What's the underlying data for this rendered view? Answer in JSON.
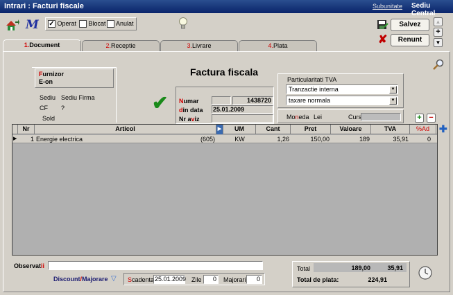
{
  "window": {
    "title": "Intrari : Facturi fiscale",
    "subunit_label": "Subunitate",
    "subunit_value": "Sediu Central"
  },
  "toolbar": {
    "operat": "Operat",
    "blocat": "Blocat",
    "anulat": "Anulat",
    "operat_checked": true
  },
  "actions": {
    "save": "Salvez",
    "cancel": "Renunt"
  },
  "tabs": [
    {
      "num": "1.",
      "label": "Document"
    },
    {
      "num": "2.",
      "label": "Receptie"
    },
    {
      "num": "3.",
      "label": "Livrare"
    },
    {
      "num": "4.",
      "label": "Plata"
    }
  ],
  "supplier": {
    "label_l1": "F",
    "label_r1": "urnizor",
    "name": "E-on",
    "sediu_label": "Sediu",
    "sediu_value": "Sediu Firma",
    "cf_label": "CF",
    "cf_value": "?",
    "sold_label": "Sold"
  },
  "invoice": {
    "title": "Factura fiscala",
    "numar_l": "N",
    "numar_r": "umar",
    "numar_value": "1438720",
    "data_l": "d",
    "data_r": "in data",
    "data_value": "25.01.2009",
    "aviz_l": "Nr a",
    "aviz_m": "v",
    "aviz_r": "iz",
    "aviz_value": ""
  },
  "tva": {
    "title": "Particularitati TVA",
    "option1": "Tranzactie interna",
    "option2": "taxare normala"
  },
  "currency": {
    "moneda_label_l": "Mo",
    "moneda_label_m": "n",
    "moneda_label_r": "eda",
    "moneda_value": "Lei",
    "curs_label": "Curs",
    "curs_value": ""
  },
  "grid": {
    "columns": [
      "Nr",
      "Articol",
      "UM",
      "Cant",
      "Pret",
      "Valoare",
      "TVA",
      "%Ad"
    ],
    "rows": [
      {
        "nr": "1",
        "articol": "Energie electrica",
        "code": "(605)",
        "um": "KW",
        "cant": "1,26",
        "pret": "150,00",
        "valoare": "189",
        "tva": "35,91",
        "ad": "0"
      }
    ]
  },
  "footer": {
    "obs_label_l": "Observat",
    "obs_label_r": "ii",
    "obs_value": "",
    "discount_label_l": "Discount",
    "discount_label_m": "/",
    "discount_label_r": "Majorare",
    "scadenta_l": "S",
    "scadenta_r": "cadenta",
    "scadenta_value": "25.01.2009",
    "zile_label": "Zile",
    "zile_value": "0",
    "majorari_label": "Majorari",
    "majorari_value": "0"
  },
  "totals": {
    "total_label": "Total",
    "total_value": "189,00",
    "total_tva": "35,91",
    "plata_label": "Total de plata:",
    "plata_value": "224,91"
  },
  "colors": {
    "titlebar": "#0a246a",
    "red": "#d00000",
    "green_check": "#1a8a1a"
  }
}
